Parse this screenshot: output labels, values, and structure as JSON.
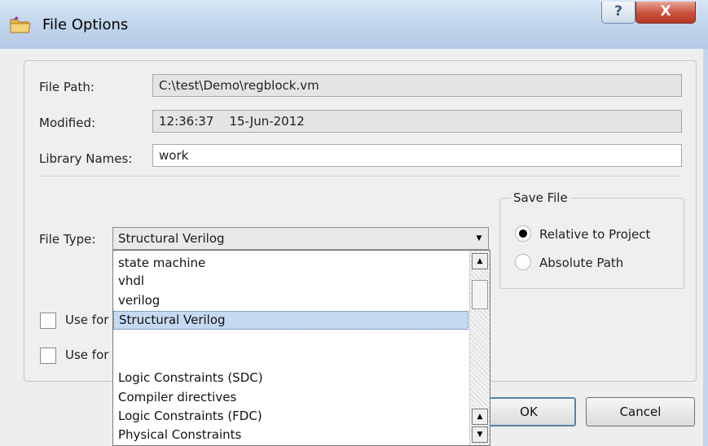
{
  "window": {
    "title": "File Options",
    "help_glyph": "?",
    "close_glyph": "X"
  },
  "form": {
    "file_path_label": "File Path:",
    "file_path_value": "C:\\test\\Demo\\regblock.vm",
    "modified_label": "Modified:",
    "modified_value": "12:36:37    15-Jun-2012",
    "library_names_label": "Library Names:",
    "library_names_value": "work",
    "file_type_label": "File Type:",
    "file_type_value": "Structural Verilog"
  },
  "file_type_options": [
    "state machine",
    "vhdl",
    "verilog",
    "Structural Verilog",
    "",
    "Logic Constraints (SDC)",
    "Compiler directives",
    "Logic Constraints (FDC)",
    "Physical Constraints"
  ],
  "save_file": {
    "legend": "Save File",
    "option_relative": "Relative to Project",
    "option_absolute": "Absolute Path",
    "selected": "Relative to Project"
  },
  "checkboxes": {
    "first_label": "Use for",
    "second_label": "Use for"
  },
  "buttons": {
    "ok": "OK",
    "cancel": "Cancel"
  },
  "icons": {
    "app": "folder-icon",
    "help": "help-icon",
    "close": "close-icon",
    "dropdown": "chevron-down-icon",
    "scroll_up": "arrow-up-icon",
    "scroll_down": "arrow-down-icon"
  },
  "colors": {
    "titlebar": "#c2d6ec",
    "close_button": "#c9503a",
    "selected_item": "#c5daf2"
  }
}
